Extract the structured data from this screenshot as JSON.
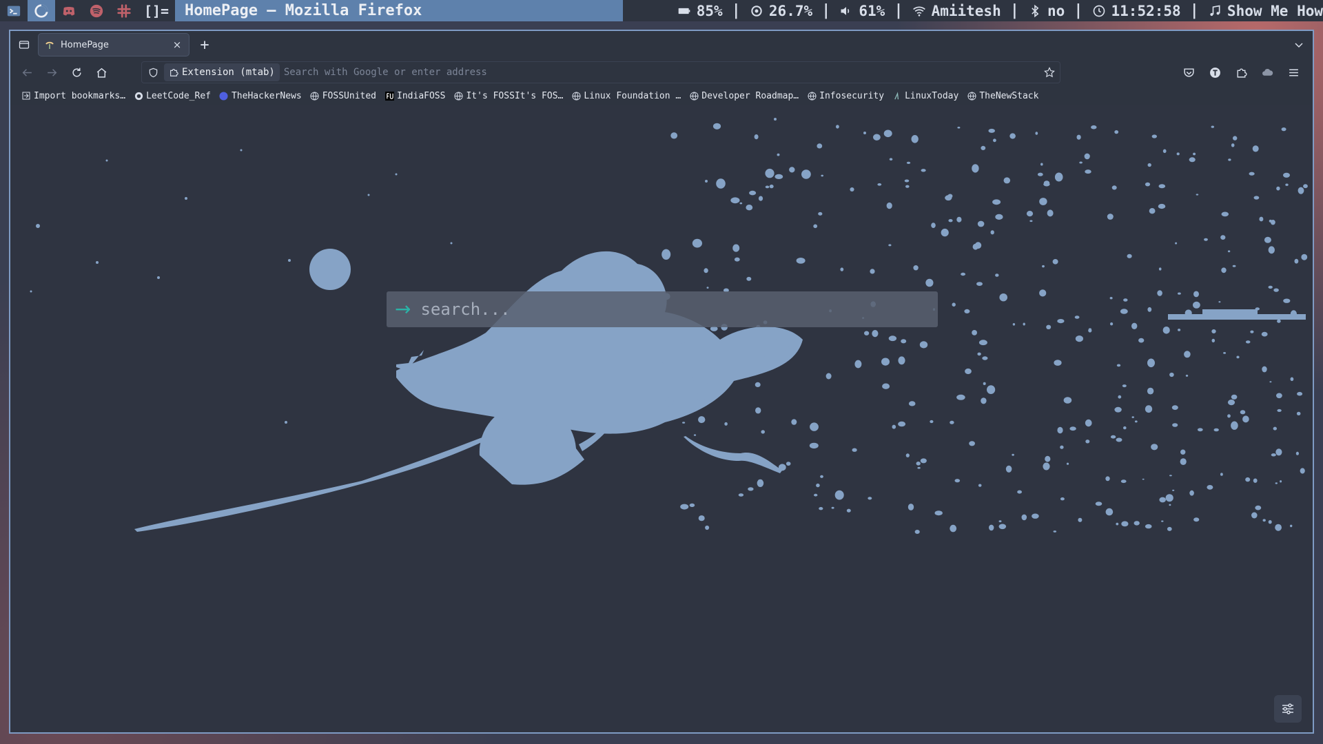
{
  "topbar": {
    "tags": [
      {
        "icon": "terminal-icon"
      },
      {
        "icon": "firefox-icon",
        "active": true
      },
      {
        "icon": "discord-icon"
      },
      {
        "icon": "spotify-icon"
      },
      {
        "icon": "slack-icon"
      }
    ],
    "layout": "[]=",
    "window_title": "HomePage — Mozilla Firefox",
    "status": {
      "battery": "85%",
      "cpu": "26.7%",
      "volume": "61%",
      "wifi": "Amiitesh",
      "bluetooth": "no",
      "clock": "11:52:58",
      "music": "Show Me How"
    },
    "separator": "|"
  },
  "browser": {
    "tab": {
      "title": "HomePage",
      "close": "×"
    },
    "new_tab": "+",
    "url": {
      "extension_label": "Extension (mtab)",
      "placeholder": "Search with Google or enter address"
    },
    "bookmarks": [
      {
        "label": "Import bookmarks…",
        "icon": "import-icon"
      },
      {
        "label": "LeetCode_Ref",
        "icon": "github-icon"
      },
      {
        "label": "TheHackerNews",
        "icon": "thn-icon"
      },
      {
        "label": "FOSSUnited",
        "icon": "globe-icon"
      },
      {
        "label": "IndiaFOSS",
        "icon": "fu-icon"
      },
      {
        "label": "It's FOSSIt's FOS…",
        "icon": "globe-icon"
      },
      {
        "label": "Linux Foundation …",
        "icon": "globe-icon"
      },
      {
        "label": "Developer Roadmap…",
        "icon": "globe-icon"
      },
      {
        "label": "Infosecurity",
        "icon": "globe-icon"
      },
      {
        "label": "LinuxToday",
        "icon": "linuxtoday-icon"
      },
      {
        "label": "TheNewStack",
        "icon": "globe-icon"
      }
    ]
  },
  "page": {
    "search_arrow": "→",
    "search_placeholder": "search..."
  },
  "colors": {
    "accent": "#5e81ac",
    "art": "#86a3c6",
    "search_arrow": "#2bb3a7",
    "background": "#2f3441"
  }
}
